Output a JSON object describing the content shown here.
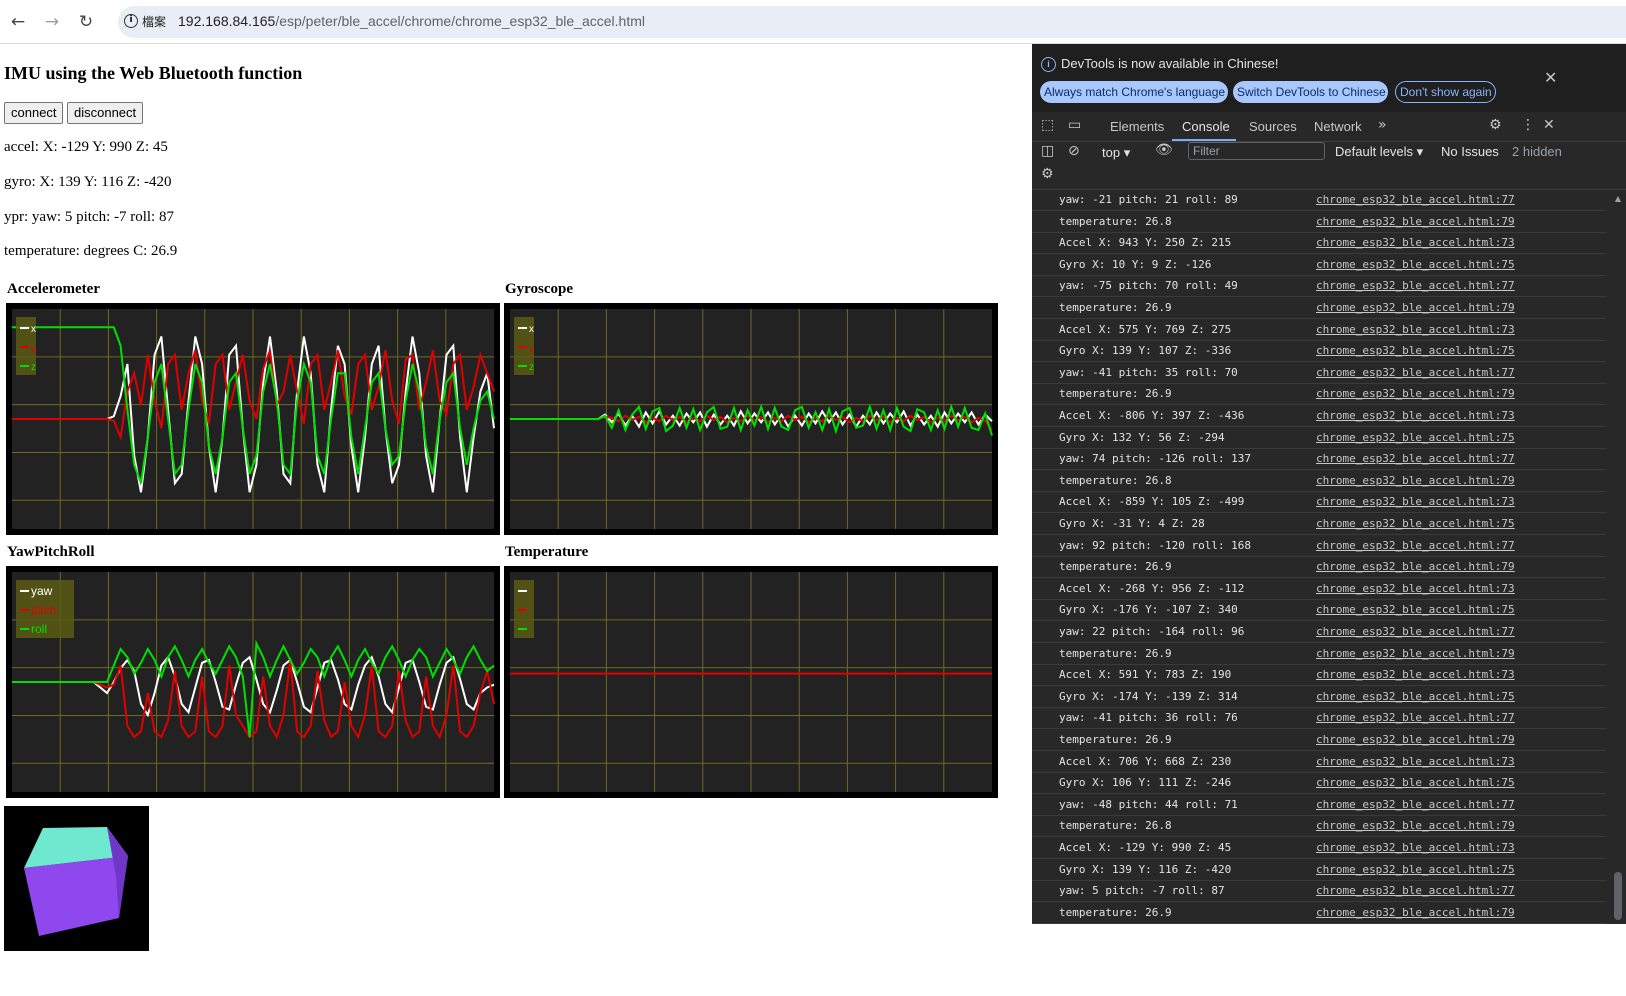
{
  "browser": {
    "file_badge": "檔案",
    "url_host": "192.168.84.165",
    "url_path": "/esp/peter/ble_accel/chrome/chrome_esp32_ble_accel.html"
  },
  "page": {
    "title": "IMU using the Web Bluetooth function",
    "connect_label": "connect",
    "disconnect_label": "disconnect",
    "accel_line": "accel: X: -129 Y: 990 Z: 45",
    "gyro_line": "gyro: X: 139 Y: 116 Z: -420",
    "ypr_line": "ypr: yaw: 5 pitch: -7 roll: 87",
    "temp_line": "temperature: degrees C: 26.9"
  },
  "colors": {
    "grid": "#6b6b1e",
    "white": "#ffffff",
    "red": "#e00000",
    "green": "#00e000",
    "plot_bg": "#222222",
    "cube_top": "#6ee8cf",
    "cube_front": "#8f47ee",
    "cube_side": "#6f36c8"
  },
  "chart_data": [
    {
      "type": "line",
      "title": "Accelerometer",
      "legend": [
        "x",
        "y",
        "z"
      ],
      "ylim": [
        -1200,
        1200
      ],
      "series": [
        {
          "name": "x",
          "color": "#ffffff",
          "values": [
            0,
            0,
            0,
            0,
            0,
            0,
            0,
            0,
            0,
            0,
            0,
            0,
            0,
            0,
            0,
            30,
            250,
            600,
            -400,
            -800,
            -200,
            700,
            900,
            100,
            -700,
            -600,
            200,
            900,
            600,
            -300,
            -800,
            -200,
            700,
            800,
            -100,
            -800,
            -500,
            400,
            900,
            300,
            -600,
            -700,
            300,
            900,
            500,
            -500,
            -800,
            100,
            800,
            600,
            -300,
            -800,
            -200,
            600,
            800,
            -100,
            -700,
            -500,
            300,
            900,
            500,
            -400,
            -800,
            0,
            700,
            800,
            -200,
            -800,
            -200,
            300,
            500,
            -100
          ]
        },
        {
          "name": "y",
          "color": "#e00000",
          "values": [
            0,
            0,
            0,
            0,
            0,
            0,
            0,
            0,
            0,
            0,
            0,
            0,
            0,
            0,
            0,
            -20,
            -200,
            300,
            500,
            150,
            700,
            200,
            -100,
            600,
            700,
            100,
            500,
            750,
            200,
            -50,
            600,
            700,
            100,
            400,
            700,
            200,
            0,
            550,
            750,
            150,
            300,
            700,
            300,
            -50,
            600,
            700,
            100,
            400,
            750,
            250,
            50,
            600,
            700,
            100,
            350,
            750,
            200,
            -50,
            650,
            700,
            100,
            400,
            750,
            200,
            50,
            600,
            700,
            100,
            350,
            700,
            500,
            300
          ]
        },
        {
          "name": "z",
          "color": "#00e000",
          "values": [
            1000,
            1000,
            1000,
            1000,
            1000,
            1000,
            1000,
            1000,
            1000,
            1000,
            1000,
            1000,
            1000,
            1000,
            1000,
            1000,
            800,
            100,
            -500,
            -700,
            -200,
            400,
            600,
            0,
            -600,
            -500,
            100,
            600,
            400,
            -300,
            -600,
            -200,
            400,
            500,
            -100,
            -600,
            -400,
            300,
            600,
            200,
            -500,
            -600,
            200,
            600,
            400,
            -400,
            -600,
            0,
            500,
            500,
            -200,
            -600,
            -100,
            400,
            500,
            -100,
            -500,
            -400,
            200,
            600,
            300,
            -300,
            -600,
            0,
            400,
            500,
            -100,
            -500,
            -100,
            200,
            300,
            0
          ]
        }
      ]
    },
    {
      "type": "line",
      "title": "Gyroscope",
      "legend": [
        "x",
        "y",
        "z"
      ],
      "ylim": [
        -2000,
        2000
      ],
      "series": [
        {
          "name": "x",
          "color": "#ffffff",
          "values": [
            0,
            0,
            0,
            0,
            0,
            0,
            0,
            0,
            0,
            0,
            0,
            0,
            0,
            0,
            80,
            -60,
            100,
            -120,
            60,
            -140,
            120,
            -80,
            140,
            -100,
            60,
            -120,
            100,
            -60,
            120,
            -140,
            80,
            -100,
            60,
            -120,
            140,
            -80,
            100,
            -60,
            120,
            -100,
            80,
            -140,
            60,
            -120,
            100,
            -80,
            140,
            -60,
            120,
            -100,
            80,
            -140,
            60,
            -100,
            120,
            -80,
            100,
            -60,
            140,
            -120,
            80,
            -100,
            60,
            -140,
            120,
            -80,
            100,
            -60,
            120,
            -100,
            80,
            -40
          ]
        },
        {
          "name": "y",
          "color": "#e00000",
          "values": [
            0,
            0,
            0,
            0,
            0,
            0,
            0,
            0,
            0,
            0,
            0,
            0,
            0,
            0,
            40,
            20,
            -40,
            60,
            -20,
            40,
            -60,
            20,
            -40,
            60,
            -20,
            40,
            -60,
            20,
            -40,
            60,
            -20,
            40,
            -60,
            20,
            -40,
            60,
            -20,
            40,
            -60,
            20,
            -40,
            60,
            -20,
            40,
            -60,
            20,
            -40,
            60,
            -20,
            40,
            -60,
            20,
            -40,
            60,
            -20,
            40,
            -60,
            20,
            -40,
            60,
            -20,
            40,
            -60,
            20,
            -40,
            60,
            -20,
            40,
            -60,
            20,
            -40,
            -200
          ]
        },
        {
          "name": "z",
          "color": "#00e000",
          "values": [
            0,
            0,
            0,
            0,
            0,
            0,
            0,
            0,
            0,
            0,
            0,
            0,
            0,
            0,
            60,
            -160,
            160,
            -200,
            80,
            220,
            -180,
            140,
            200,
            -220,
            -120,
            200,
            -160,
            180,
            -200,
            120,
            220,
            -180,
            -140,
            200,
            -200,
            160,
            -120,
            220,
            -180,
            200,
            -140,
            -200,
            160,
            220,
            -160,
            120,
            -200,
            180,
            -220,
            140,
            200,
            -160,
            -120,
            220,
            -180,
            160,
            -200,
            200,
            -140,
            -220,
            180,
            120,
            -200,
            160,
            -180,
            220,
            -140,
            200,
            -160,
            -200,
            100,
            -300
          ]
        }
      ]
    },
    {
      "type": "line",
      "title": "YawPitchRoll",
      "legend": [
        "yaw",
        "pitch",
        "roll"
      ],
      "ylim": [
        -200,
        200
      ],
      "series": [
        {
          "name": "yaw",
          "color": "#ffffff",
          "values": [
            0,
            0,
            0,
            0,
            0,
            0,
            0,
            0,
            0,
            0,
            0,
            0,
            0,
            -10,
            -20,
            0,
            25,
            40,
            20,
            -40,
            -60,
            -20,
            30,
            45,
            10,
            -40,
            -55,
            -10,
            35,
            40,
            0,
            -45,
            -50,
            -5,
            35,
            45,
            5,
            -40,
            -55,
            -15,
            30,
            40,
            0,
            -45,
            -55,
            -10,
            35,
            40,
            5,
            -40,
            -50,
            -5,
            30,
            45,
            10,
            -40,
            -55,
            -10,
            35,
            40,
            0,
            -45,
            -50,
            -5,
            35,
            45,
            5,
            -40,
            -50,
            -20,
            -10,
            -5
          ]
        },
        {
          "name": "pitch",
          "color": "#e00000",
          "values": [
            0,
            0,
            0,
            0,
            0,
            0,
            0,
            0,
            0,
            0,
            0,
            0,
            0,
            -5,
            -10,
            -5,
            30,
            -80,
            -100,
            -90,
            -20,
            -90,
            -100,
            -70,
            20,
            -80,
            -100,
            -90,
            10,
            -90,
            -100,
            -80,
            30,
            -60,
            -80,
            -100,
            -90,
            10,
            -80,
            -100,
            -60,
            40,
            -90,
            -100,
            -80,
            20,
            -70,
            -100,
            -90,
            0,
            -80,
            -100,
            -60,
            30,
            -90,
            -100,
            -80,
            20,
            -70,
            -100,
            -90,
            10,
            -80,
            -100,
            -60,
            30,
            -90,
            -100,
            -80,
            -20,
            20,
            -40
          ]
        },
        {
          "name": "roll",
          "color": "#00e000",
          "values": [
            0,
            0,
            0,
            0,
            0,
            0,
            0,
            0,
            0,
            0,
            0,
            0,
            0,
            0,
            0,
            30,
            60,
            45,
            15,
            35,
            60,
            40,
            10,
            45,
            65,
            40,
            10,
            40,
            60,
            35,
            15,
            40,
            65,
            45,
            10,
            -100,
            70,
            45,
            10,
            40,
            65,
            40,
            15,
            35,
            60,
            45,
            10,
            45,
            65,
            40,
            10,
            40,
            60,
            35,
            15,
            45,
            65,
            40,
            10,
            40,
            60,
            45,
            10,
            35,
            60,
            40,
            15,
            45,
            65,
            40,
            20,
            30
          ]
        }
      ]
    },
    {
      "type": "line",
      "title": "Temperature",
      "legend": [
        "",
        "",
        ""
      ],
      "ylim": [
        0,
        50
      ],
      "series": [
        {
          "name": "",
          "color": "#e00000",
          "values": [
            26.9,
            26.9,
            26.9,
            26.9,
            26.9,
            26.9,
            26.9,
            26.9,
            26.9,
            26.9,
            26.9,
            26.9,
            26.9,
            26.9,
            26.9,
            26.9,
            26.9,
            26.9,
            26.9,
            26.9,
            26.9,
            26.9,
            26.9,
            26.9,
            26.9,
            26.9,
            26.9,
            26.9,
            26.9,
            26.9,
            26.9,
            26.9,
            26.9,
            26.9,
            26.9,
            26.9,
            26.9,
            26.9,
            26.9,
            26.9
          ]
        }
      ]
    }
  ],
  "devtools": {
    "info_text": "DevTools is now available in Chinese!",
    "pill1": "Always match Chrome's language",
    "pill2": "Switch DevTools to Chinese",
    "pill3": "Don't show again",
    "tabs": [
      "Elements",
      "Console",
      "Sources",
      "Network"
    ],
    "context": "top",
    "filter_placeholder": "Filter",
    "levels": "Default levels",
    "issues": "No Issues",
    "hidden": "2 hidden",
    "logs": [
      {
        "msg": "yaw: -21 pitch: 21 roll: 89",
        "src": "chrome_esp32_ble_accel.html:77"
      },
      {
        "msg": "temperature: 26.8",
        "src": "chrome_esp32_ble_accel.html:79"
      },
      {
        "msg": "Accel X: 943 Y: 250 Z: 215",
        "src": "chrome_esp32_ble_accel.html:73"
      },
      {
        "msg": "Gyro X: 10 Y: 9 Z: -126",
        "src": "chrome_esp32_ble_accel.html:75"
      },
      {
        "msg": "yaw: -75 pitch: 70 roll: 49",
        "src": "chrome_esp32_ble_accel.html:77"
      },
      {
        "msg": "temperature: 26.9",
        "src": "chrome_esp32_ble_accel.html:79"
      },
      {
        "msg": "Accel X: 575 Y: 769 Z: 275",
        "src": "chrome_esp32_ble_accel.html:73"
      },
      {
        "msg": "Gyro X: 139 Y: 107 Z: -336",
        "src": "chrome_esp32_ble_accel.html:75"
      },
      {
        "msg": "yaw: -41 pitch: 35 roll: 70",
        "src": "chrome_esp32_ble_accel.html:77"
      },
      {
        "msg": "temperature: 26.9",
        "src": "chrome_esp32_ble_accel.html:79"
      },
      {
        "msg": "Accel X: -806 Y: 397 Z: -436",
        "src": "chrome_esp32_ble_accel.html:73"
      },
      {
        "msg": "Gyro X: 132 Y: 56 Z: -294",
        "src": "chrome_esp32_ble_accel.html:75"
      },
      {
        "msg": "yaw: 74 pitch: -126 roll: 137",
        "src": "chrome_esp32_ble_accel.html:77"
      },
      {
        "msg": "temperature: 26.8",
        "src": "chrome_esp32_ble_accel.html:79"
      },
      {
        "msg": "Accel X: -859 Y: 105 Z: -499",
        "src": "chrome_esp32_ble_accel.html:73"
      },
      {
        "msg": "Gyro X: -31 Y: 4 Z: 28",
        "src": "chrome_esp32_ble_accel.html:75"
      },
      {
        "msg": "yaw: 92 pitch: -120 roll: 168",
        "src": "chrome_esp32_ble_accel.html:77"
      },
      {
        "msg": "temperature: 26.9",
        "src": "chrome_esp32_ble_accel.html:79"
      },
      {
        "msg": "Accel X: -268 Y: 956 Z: -112",
        "src": "chrome_esp32_ble_accel.html:73"
      },
      {
        "msg": "Gyro X: -176 Y: -107 Z: 340",
        "src": "chrome_esp32_ble_accel.html:75"
      },
      {
        "msg": "yaw: 22 pitch: -164 roll: 96",
        "src": "chrome_esp32_ble_accel.html:77"
      },
      {
        "msg": "temperature: 26.9",
        "src": "chrome_esp32_ble_accel.html:79"
      },
      {
        "msg": "Accel X: 591 Y: 783 Z: 190",
        "src": "chrome_esp32_ble_accel.html:73"
      },
      {
        "msg": "Gyro X: -174 Y: -139 Z: 314",
        "src": "chrome_esp32_ble_accel.html:75"
      },
      {
        "msg": "yaw: -41 pitch: 36 roll: 76",
        "src": "chrome_esp32_ble_accel.html:77"
      },
      {
        "msg": "temperature: 26.9",
        "src": "chrome_esp32_ble_accel.html:79"
      },
      {
        "msg": "Accel X: 706 Y: 668 Z: 230",
        "src": "chrome_esp32_ble_accel.html:73"
      },
      {
        "msg": "Gyro X: 106 Y: 111 Z: -246",
        "src": "chrome_esp32_ble_accel.html:75"
      },
      {
        "msg": "yaw: -48 pitch: 44 roll: 71",
        "src": "chrome_esp32_ble_accel.html:77"
      },
      {
        "msg": "temperature: 26.8",
        "src": "chrome_esp32_ble_accel.html:79"
      },
      {
        "msg": "Accel X: -129 Y: 990 Z: 45",
        "src": "chrome_esp32_ble_accel.html:73"
      },
      {
        "msg": "Gyro X: 139 Y: 116 Z: -420",
        "src": "chrome_esp32_ble_accel.html:75"
      },
      {
        "msg": "yaw: 5 pitch: -7 roll: 87",
        "src": "chrome_esp32_ble_accel.html:77"
      },
      {
        "msg": "temperature: 26.9",
        "src": "chrome_esp32_ble_accel.html:79"
      }
    ]
  }
}
